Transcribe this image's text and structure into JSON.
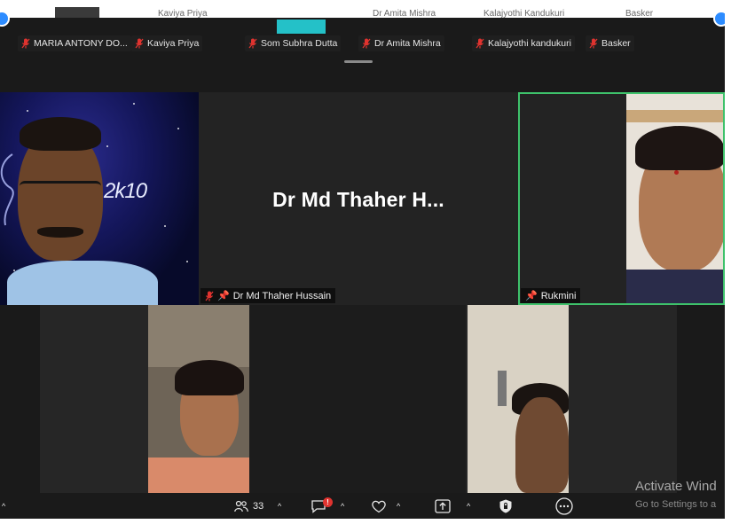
{
  "top_strip": {
    "cut_names": [
      "Kaviya Priya",
      "Dr Amita Mishra",
      "Kalajyothi Kandukuri",
      "Basker"
    ],
    "participants": [
      {
        "name": "MARIA ANTONY DO...",
        "muted": true
      },
      {
        "name": "Kaviya Priya",
        "muted": true
      },
      {
        "name": "Som Subhra Dutta",
        "muted": true
      },
      {
        "name": "Dr Amita Mishra",
        "muted": true
      },
      {
        "name": "Kalajyothi kandukuri",
        "muted": true
      },
      {
        "name": "Basker",
        "muted": true
      }
    ]
  },
  "tiles": {
    "center_name_display": "Dr Md Thaher H...",
    "center_label": "Dr Md Thaher Hussain",
    "right_label": "Rukmini",
    "left_bg_text": "2k10"
  },
  "toolbar": {
    "participants_count": "33",
    "chat_badge": "!"
  },
  "watermark": {
    "line1": "Activate Wind",
    "line2": "Go to Settings to a"
  },
  "colors": {
    "active_speaker_border": "#3ec26b",
    "mic_off_red": "#e0332f",
    "screen_bg": "#1a1a1a"
  }
}
